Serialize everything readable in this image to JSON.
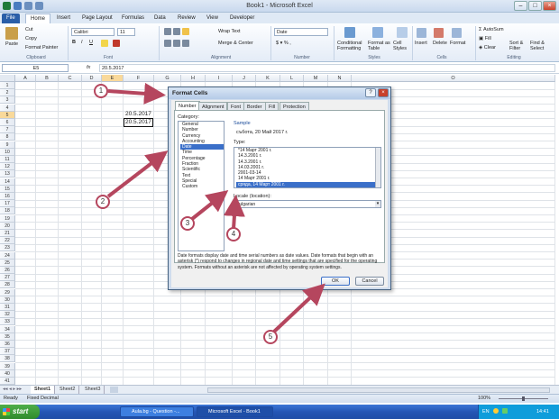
{
  "window": {
    "title": "Book1 - Microsoft Excel"
  },
  "tabs": [
    "File",
    "Home",
    "Insert",
    "Page Layout",
    "Formulas",
    "Data",
    "Review",
    "View",
    "Developer"
  ],
  "ribbon": {
    "clipboard": {
      "paste": "Paste",
      "cut": "Cut",
      "copy": "Copy",
      "format_painter": "Format Painter",
      "group": "Clipboard"
    },
    "font": {
      "name": "Calibri",
      "size": "11",
      "group": "Font"
    },
    "alignment": {
      "wrap": "Wrap Text",
      "merge": "Merge & Center",
      "group": "Alignment"
    },
    "number": {
      "format": "Date",
      "group": "Number"
    },
    "styles": {
      "cond": "Conditional Formatting",
      "fmt_table": "Format as Table",
      "cell_styles": "Cell Styles",
      "group": "Styles"
    },
    "cells": {
      "insert": "Insert",
      "delete": "Delete",
      "format": "Format",
      "group": "Cells"
    },
    "editing": {
      "autosum": "AutoSum",
      "fill": "Fill",
      "clear": "Clear",
      "sort": "Sort & Filter",
      "find": "Find & Select",
      "group": "Editing"
    }
  },
  "formula_bar": {
    "name_box": "E5",
    "fx": "fx",
    "value": "20.5.2017"
  },
  "columns": [
    "A",
    "B",
    "C",
    "D",
    "E",
    "F",
    "G",
    "H",
    "I",
    "J",
    "K",
    "L",
    "M",
    "N",
    "O"
  ],
  "rows": [
    "1",
    "2",
    "3",
    "4",
    "5",
    "6",
    "7",
    "8",
    "9",
    "10",
    "11",
    "12",
    "13",
    "14",
    "15",
    "16",
    "17",
    "18",
    "19",
    "20",
    "21",
    "22",
    "23",
    "24",
    "25",
    "26",
    "27",
    "28",
    "29",
    "30",
    "31",
    "32",
    "33",
    "34",
    "35",
    "36",
    "37",
    "38",
    "39",
    "40",
    "41"
  ],
  "cells": {
    "e4": "20.5.2017",
    "e5": "20.5.2017"
  },
  "sheets": [
    "Sheet1",
    "Sheet2",
    "Sheet3"
  ],
  "status": {
    "ready": "Ready",
    "fixed": "Fixed Decimal",
    "zoom": "100%"
  },
  "dialog": {
    "title": "Format Cells",
    "tabs": [
      "Number",
      "Alignment",
      "Font",
      "Border",
      "Fill",
      "Protection"
    ],
    "category_label": "Category:",
    "categories": [
      "General",
      "Number",
      "Currency",
      "Accounting",
      "Date",
      "Time",
      "Percentage",
      "Fraction",
      "Scientific",
      "Text",
      "Special",
      "Custom"
    ],
    "selected_category": "Date",
    "sample_label": "Sample",
    "sample_value": "събота, 20 Май 2017 г.",
    "type_label": "Type:",
    "types": [
      "*14 Март 2001 г.",
      "14.3.2001 г.",
      "14.3.2001 г.",
      "14.03.2001 г.",
      "2001-03-14",
      "14 Март 2001 г.",
      "сряда, 14 Март 2001 г."
    ],
    "selected_type": "сряда, 14 Март 2001 г.",
    "locale_label": "Locale (location):",
    "locale_value": "Bulgarian",
    "description": "Date formats display date and time serial numbers as date values.  Date formats that begin with an asterisk (*) respond to changes in regional date and time settings that are specified for the operating system. Formats without an asterisk are not affected by operating system settings.",
    "ok": "OK",
    "cancel": "Cancel"
  },
  "callouts": [
    "1",
    "2",
    "3",
    "4",
    "5"
  ],
  "taskbar": {
    "start": "start",
    "items": [
      "Aula.bg - Question -...",
      "Microsoft Excel - Book1"
    ],
    "lang": "EN",
    "clock": "14:41"
  },
  "colors": {
    "accent": "#2a5ea8",
    "callout": "#b5465e",
    "selection": "#3a6fc9"
  }
}
